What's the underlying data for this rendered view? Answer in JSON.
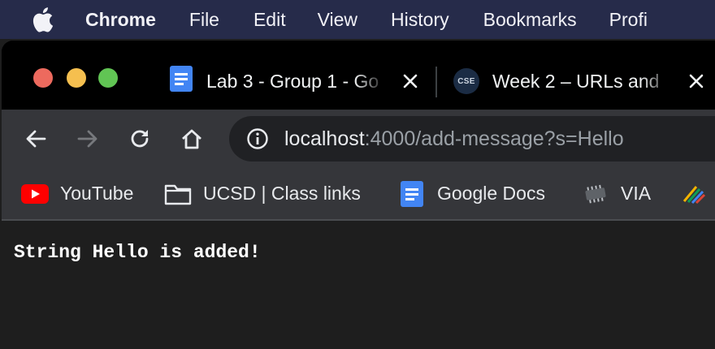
{
  "menubar": {
    "apple_icon": "apple-logo-icon",
    "items": [
      {
        "label": "Chrome"
      },
      {
        "label": "File"
      },
      {
        "label": "Edit"
      },
      {
        "label": "View"
      },
      {
        "label": "History"
      },
      {
        "label": "Bookmarks"
      },
      {
        "label": "Profi"
      }
    ]
  },
  "window": {
    "traffic_lights": [
      "#ed6a5e",
      "#f5bf4f",
      "#61c554"
    ]
  },
  "tabs": [
    {
      "title": "Lab 3 - Group 1 - Go",
      "icon": "google-docs-icon",
      "active": false
    },
    {
      "title": "Week 2 – URLs and",
      "icon": "cse-logo-icon",
      "icon_text": "CSE",
      "active": false
    }
  ],
  "toolbar": {
    "back_icon": "back-arrow-icon",
    "forward_icon": "forward-arrow-icon",
    "reload_icon": "reload-icon",
    "home_icon": "home-icon",
    "url_host": "localhost",
    "url_rest": ":4000/add-message?s=Hello"
  },
  "bookmarks": [
    {
      "label": "YouTube",
      "icon": "youtube-icon"
    },
    {
      "label": "UCSD | Class links",
      "icon": "folder-icon"
    },
    {
      "label": "Google Docs",
      "icon": "google-docs-icon"
    },
    {
      "label": "VIA",
      "icon": "chip-icon"
    },
    {
      "label": "",
      "icon": "striped-logo-icon"
    }
  ],
  "page": {
    "text": "String Hello is added!"
  },
  "colors": {
    "menubar_bg": "#262b4a",
    "tabstrip_bg": "#000000",
    "toolbar_bg": "#35363a",
    "omnibox_bg": "#202124",
    "page_bg": "#1e1e1e",
    "youtube_red": "#ff0000",
    "docs_blue": "#4285f4"
  }
}
